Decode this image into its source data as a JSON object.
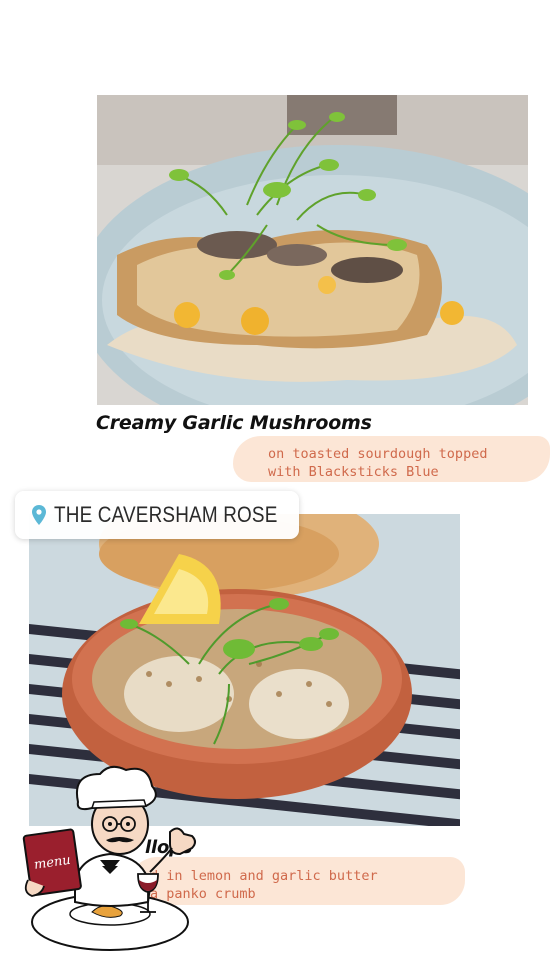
{
  "story": {
    "location_sticker": {
      "label": "THE CAVERSHAM ROSE",
      "icon": "map-pin-icon",
      "icon_color": "#5bb8d6"
    },
    "dishes": [
      {
        "title": "Creamy Garlic Mushrooms",
        "description_line1": "on toasted sourdough topped",
        "description_line2": "with Blacksticks Blue"
      },
      {
        "title": "llops",
        "description_line1": "d in lemon and garlic butter",
        "description_line2": "a panko crumb"
      }
    ],
    "chef_sticker": {
      "menu_text": "menu",
      "icon": "chef-with-menu-icon"
    },
    "colors": {
      "description_text": "#d06a4c",
      "description_highlight": "#fbe2cf"
    }
  }
}
